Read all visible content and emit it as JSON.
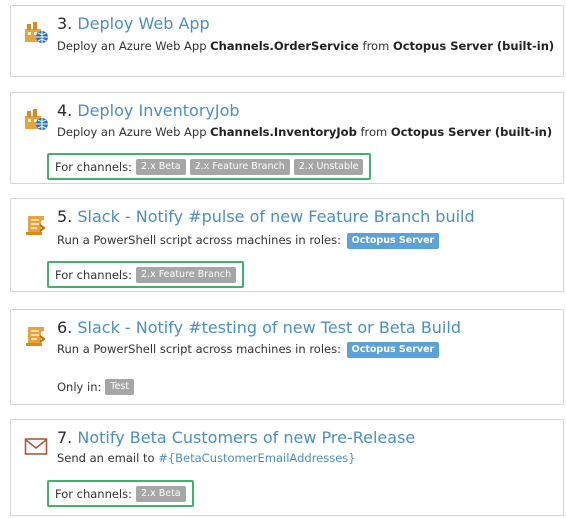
{
  "steps": [
    {
      "number": "3.",
      "name": "Deploy Web App",
      "icon": "azure-web-app-icon",
      "desc_prefix": "Deploy an Azure Web App",
      "package": "Channels.OrderService",
      "desc_mid": "from",
      "feed": "Octopus Server (built-in)"
    },
    {
      "number": "4.",
      "name": "Deploy InventoryJob",
      "icon": "azure-web-app-icon",
      "desc_prefix": "Deploy an Azure Web App",
      "package": "Channels.InventoryJob",
      "desc_mid": "from",
      "feed": "Octopus Server (built-in)",
      "channels_label": "For channels:",
      "channels": [
        "2.x Beta",
        "2.x Feature Branch",
        "2.x Unstable"
      ]
    },
    {
      "number": "5.",
      "name": "Slack - Notify #pulse of new Feature Branch build",
      "icon": "powershell-script-icon",
      "desc": "Run a PowerShell script across machines in roles:",
      "role": "Octopus Server",
      "channels_label": "For channels:",
      "channels": [
        "2.x Feature Branch"
      ]
    },
    {
      "number": "6.",
      "name": "Slack - Notify #testing of new Test or Beta Build",
      "icon": "powershell-script-icon",
      "desc": "Run a PowerShell script across machines in roles:",
      "role": "Octopus Server",
      "only_in_label": "Only in:",
      "environments": [
        "Test"
      ]
    },
    {
      "number": "7.",
      "name": "Notify Beta Customers of new Pre-Release",
      "icon": "email-icon",
      "desc_prefix": "Send an email to",
      "variable": "#{BetaCustomerEmailAddresses}",
      "channels_label": "For channels:",
      "channels": [
        "2.x Beta"
      ]
    }
  ],
  "colors": {
    "link": "#4b8fc7",
    "channel_highlight": "#3fb36b",
    "role_tag": "#5ba2d8",
    "channel_tag": "#a6a6a6"
  }
}
